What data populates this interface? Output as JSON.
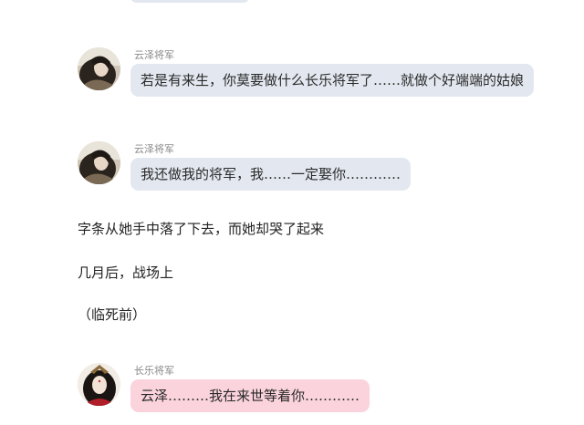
{
  "messages": [
    {
      "sender": "云泽将军",
      "text": "若是有来生，你莫要做什么长乐将军了……就做个好端端的姑娘",
      "avatar_icon": "male-general-avatar-icon",
      "bubble_color": "#e3e8f0"
    },
    {
      "sender": "云泽将军",
      "text": "我还做我的将军，我……一定娶你…………",
      "avatar_icon": "male-general-avatar-icon",
      "bubble_color": "#e3e8f0"
    },
    {
      "sender": "长乐将军",
      "text": "云泽………我在来世等着你…………",
      "avatar_icon": "female-general-avatar-icon",
      "bubble_color": "#fad3dc"
    }
  ],
  "narration": [
    "字条从她手中落了下去，而她却哭了起来",
    "几月后，战场上",
    "（临死前）"
  ]
}
